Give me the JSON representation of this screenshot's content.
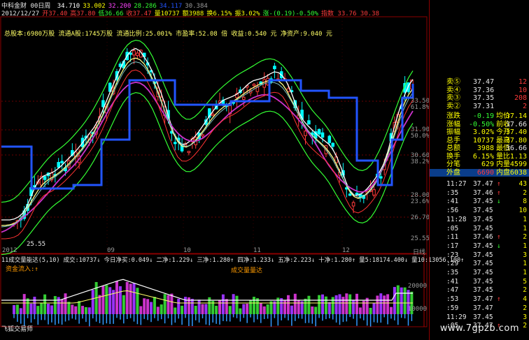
{
  "header": {
    "app": "中科金财",
    "period": "00日周",
    "ma_values": [
      {
        "label": "5",
        "text": "34.710",
        "color": "#ffffff"
      },
      {
        "label": "10",
        "text": "33.002",
        "color": "#ffff00"
      },
      {
        "label": "20",
        "text": "32.200",
        "color": "#ff44ff"
      },
      {
        "label": "30",
        "text": "28.286",
        "color": "#33ff33"
      },
      {
        "label": "60",
        "text": "34.117",
        "color": "#2255ff"
      },
      {
        "label": "120",
        "text": "30.384",
        "color": "#9a9a9a"
      }
    ],
    "row2": [
      {
        "text": "2012/12/27",
        "color": "#e8e8e8"
      },
      {
        "text": "开37.40",
        "color": "#ff3b3b"
      },
      {
        "text": "高37.80",
        "color": "#ff3b3b"
      },
      {
        "text": "低36.66",
        "color": "#33ff33"
      },
      {
        "text": "收37.47",
        "color": "#ff3b3b"
      },
      {
        "text": "量10737",
        "color": "#ffff00"
      },
      {
        "text": "额3988",
        "color": "#ffff00"
      },
      {
        "text": "换6.15%",
        "color": "#ffff00"
      },
      {
        "text": "振3.02%",
        "color": "#ffff00"
      },
      {
        "text": "涨-(0.19)-0.50%",
        "color": "#33ff33"
      },
      {
        "text": "指数 33.76 30.38",
        "color": "#ff3b3b"
      }
    ],
    "info": "总股本:6980万股   流通A股:1745万股   流通比例:25.001%   市盈率:52.08 倍   收益:0.540 元   净资产:9.040 元"
  },
  "price_axis": {
    "labels": [
      "33.50",
      "31.90",
      "30.60",
      "28.00",
      "26.70",
      "25.55"
    ],
    "pct": [
      "61.8%",
      "50.0%",
      "38.2%",
      "23.6%"
    ]
  },
  "low_label": "25.55",
  "date_axis": [
    "2012",
    "09",
    "10",
    "11",
    "12",
    "日线"
  ],
  "volume": {
    "header": "11成交量能达(5,10)  成交:10737↓ 今日净买:0.049↓ 二净:1.229↓ 三净:1.280↑ 四净:1.233↓ 五净:2.223↓ 十净:1.280↑ 量5:18174.400↓ 量10:13056.100↑",
    "sub_left": "资金流入:↑",
    "sub_center": "成交量量达",
    "axis": [
      "20000",
      "10000"
    ],
    "footer": "飞狐交易师"
  },
  "order_book": {
    "asks": [
      {
        "label": "卖⑤",
        "price": "37.47",
        "vol": "12"
      },
      {
        "label": "卖④",
        "price": "37.36",
        "vol": "10"
      },
      {
        "label": "卖③",
        "price": "37.35",
        "vol": "208"
      },
      {
        "label": "卖②",
        "price": "37.31",
        "vol": "2"
      }
    ],
    "stats": [
      {
        "k1": "涨跌",
        "v1": "-0.19",
        "k2": "均价",
        "v2": "37.14"
      },
      {
        "k1": "涨幅",
        "v1": "-0.50%",
        "k2": "前收",
        "v2": "37.66"
      },
      {
        "k1": "振幅",
        "v1": "3.02%",
        "k2": "今开",
        "v2": "37.40"
      },
      {
        "k1": "总手",
        "v1": "10737",
        "k2": "最高",
        "v2": "37.80"
      },
      {
        "k1": "总额",
        "v1": "3988",
        "k2": "最低",
        "v2": "36.66"
      },
      {
        "k1": "换手",
        "v1": "6.15%",
        "k2": "量比",
        "v2": "1.13"
      },
      {
        "k1": "分笔",
        "v1": "629",
        "k2": "内量",
        "v2": "4599"
      },
      {
        "k1": "外盘",
        "v1": "6690",
        "k2": "内盘",
        "v2": "6038"
      }
    ]
  },
  "ticks": [
    {
      "time": "11:27",
      "price": "37.47",
      "arrow": "↑",
      "vol": "43"
    },
    {
      "time": ":35",
      "price": "37.46",
      "arrow": "↑",
      "vol": "2"
    },
    {
      "time": ":41",
      "price": "37.45",
      "arrow": "↓",
      "vol": "8"
    },
    {
      "time": ":56",
      "price": "37.45",
      "arrow": "",
      "vol": "10"
    },
    {
      "time": "11:28",
      "price": "37.45",
      "arrow": "",
      "vol": "1"
    },
    {
      "time": ":05",
      "price": "37.45",
      "arrow": "",
      "vol": "1"
    },
    {
      "time": ":11",
      "price": "37.46",
      "arrow": "↑",
      "vol": "2"
    },
    {
      "time": ":17",
      "price": "37.45",
      "arrow": "↓",
      "vol": "1"
    },
    {
      "time": ":23",
      "price": "37.45",
      "arrow": "",
      "vol": "3"
    },
    {
      "time": ":29",
      "price": "37.45",
      "arrow": "",
      "vol": "1"
    },
    {
      "time": ":35",
      "price": "37.45",
      "arrow": "",
      "vol": "1"
    },
    {
      "time": ":41",
      "price": "37.45",
      "arrow": "",
      "vol": "5"
    },
    {
      "time": ":47",
      "price": "37.45",
      "arrow": "",
      "vol": "2"
    },
    {
      "time": ":53",
      "price": "37.47",
      "arrow": "↑",
      "vol": "4"
    },
    {
      "time": ":59",
      "price": "37.47",
      "arrow": "",
      "vol": "2"
    },
    {
      "time": "11:29",
      "price": "37.45",
      "arrow": "",
      "vol": "3"
    },
    {
      "time": ":05",
      "price": "37.47",
      "arrow": "↑",
      "vol": "2"
    }
  ],
  "watermark": "www.7gpzb.com",
  "colors": {
    "up": "#ff3b3b",
    "down": "#00ffff",
    "ma5": "#ffffff",
    "ma10": "#ffff66",
    "ma20": "#cc33cc",
    "band": "#33ff33",
    "ma60": "#2255ff",
    "frame": "#8b0000"
  }
}
